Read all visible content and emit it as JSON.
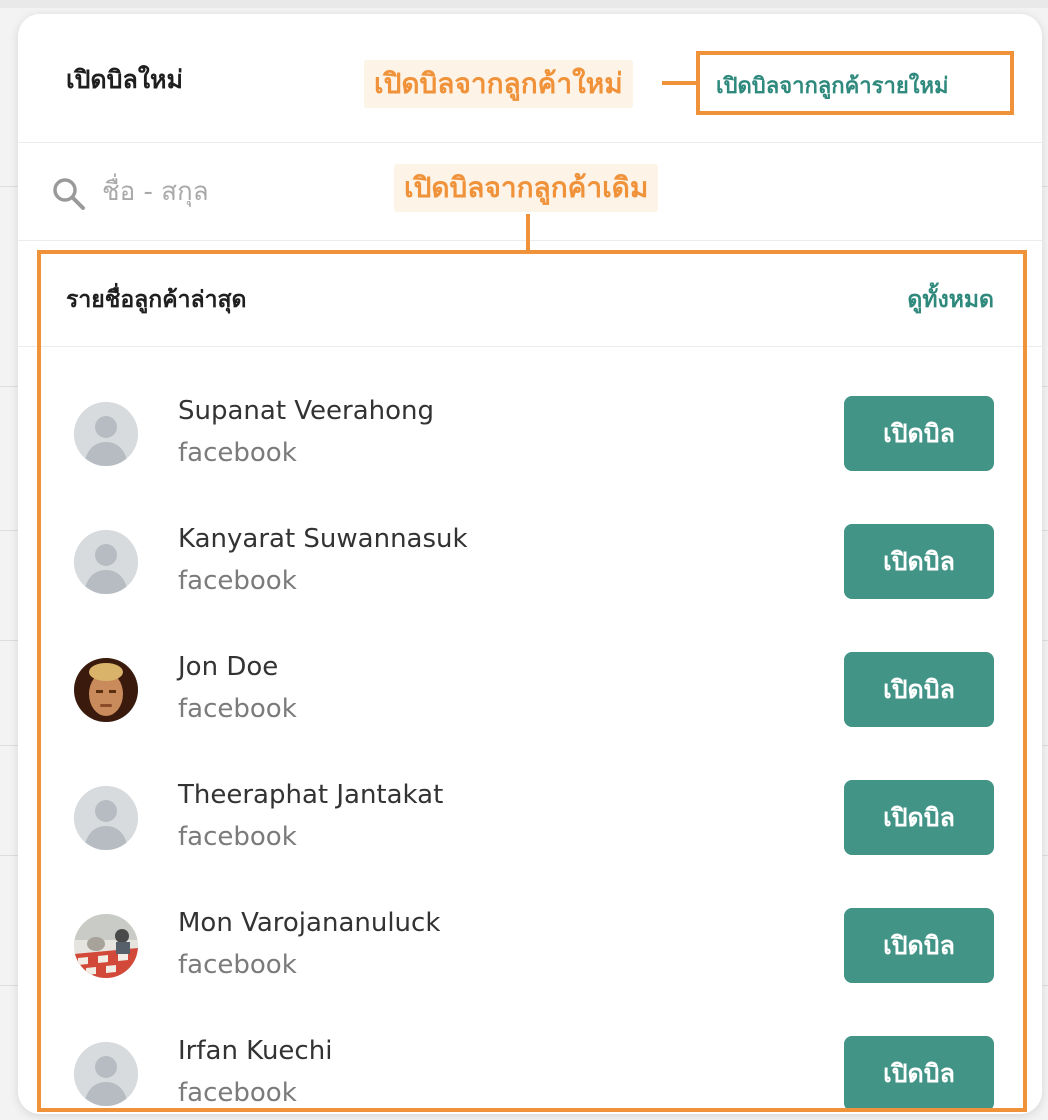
{
  "modal": {
    "title": "เปิดบิลใหม่",
    "new_customer_link": "เปิดบิลจากลูกค้ารายใหม่",
    "search": {
      "placeholder": "ชื่อ - สกุล"
    },
    "recent_section": {
      "title": "รายชื่อลูกค้าล่าสุด",
      "view_all_label": "ดูทั้งหมด",
      "customers": [
        {
          "name": "Supanat Veerahong",
          "source": "facebook",
          "avatar": "default-avatar",
          "button_label": "เปิดบิล"
        },
        {
          "name": "Kanyarat Suwannasuk",
          "source": "facebook",
          "avatar": "default-avatar",
          "button_label": "เปิดบิล"
        },
        {
          "name": "Jon Doe",
          "source": "facebook",
          "avatar": "photo-avatar",
          "button_label": "เปิดบิล"
        },
        {
          "name": "Theeraphat Jantakat",
          "source": "facebook",
          "avatar": "default-avatar",
          "button_label": "เปิดบิล"
        },
        {
          "name": "Mon Varojananuluck",
          "source": "facebook",
          "avatar": "photo-avatar",
          "button_label": "เปิดบิล"
        },
        {
          "name": "Irfan Kuechi",
          "source": "facebook",
          "avatar": "default-avatar",
          "button_label": "เปิดบิล"
        }
      ]
    }
  },
  "annotations": {
    "new_customer": "เปิดบิลจากลูกค้าใหม่",
    "existing_customer": "เปิดบิลจากลูกค้าเดิม"
  },
  "colors": {
    "accent_green": "#419486",
    "link_green": "#2f8a7d",
    "annotation_orange": "#f0923a"
  }
}
